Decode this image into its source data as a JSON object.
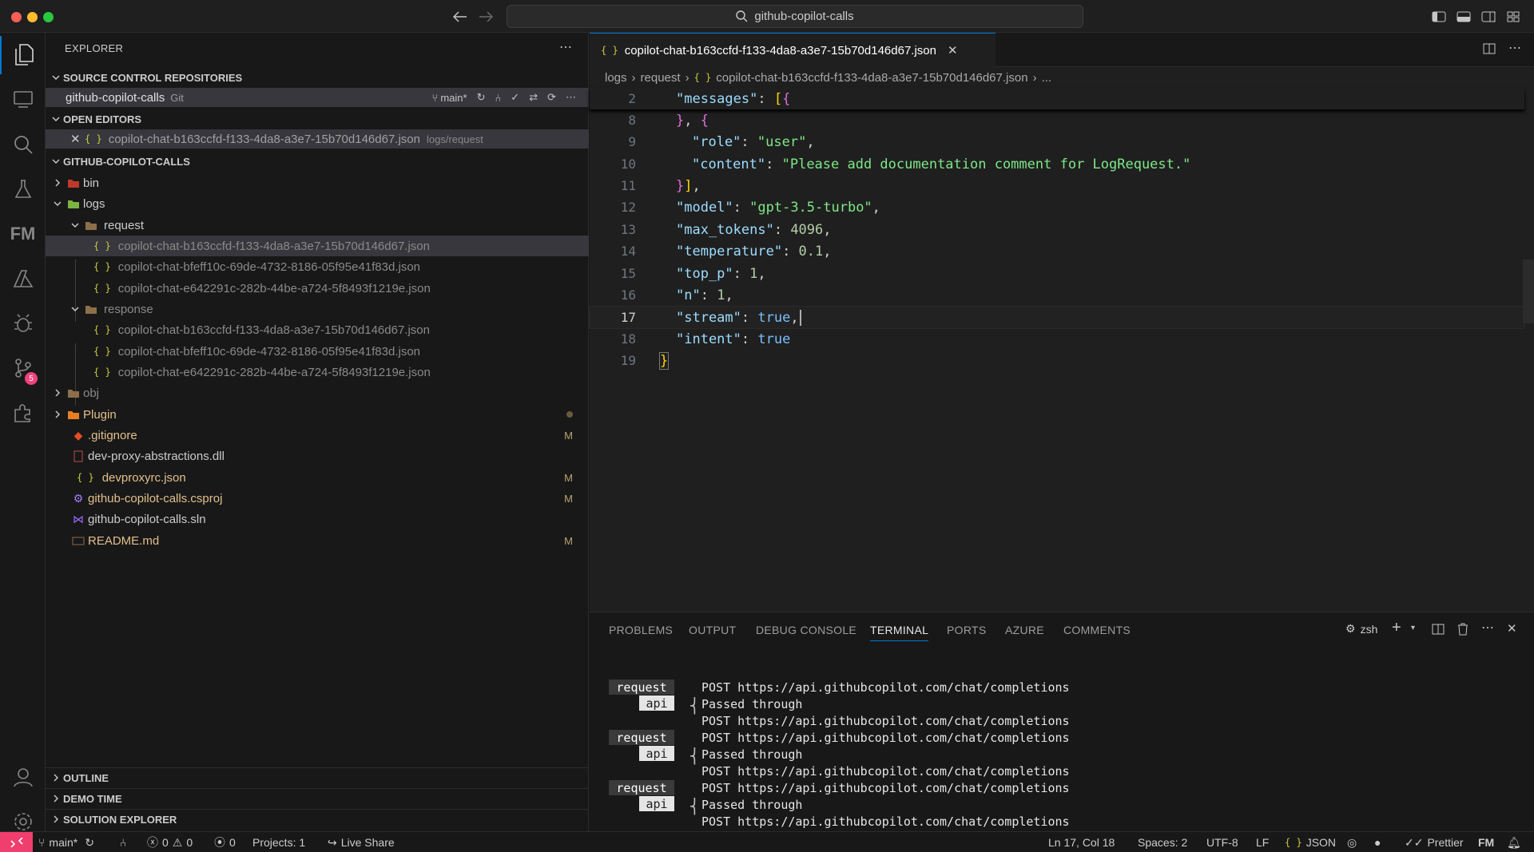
{
  "titlebar": {
    "search": "github-copilot-calls"
  },
  "activity": {
    "source_control_badge": "5"
  },
  "explorer": {
    "header": "EXPLORER",
    "scm_section": "SOURCE CONTROL REPOSITORIES",
    "repo": {
      "name": "github-copilot-calls",
      "type": "Git",
      "branch": "main*"
    },
    "open_editors_section": "OPEN EDITORS",
    "open_editor": {
      "name": "copilot-chat-b163ccfd-f133-4da8-a3e7-15b70d146d67.json",
      "path": "logs/request"
    },
    "folder_section": "GITHUB-COPILOT-CALLS",
    "tree": {
      "bin": "bin",
      "logs": "logs",
      "request": "request",
      "req1": "copilot-chat-b163ccfd-f133-4da8-a3e7-15b70d146d67.json",
      "req2": "copilot-chat-bfeff10c-69de-4732-8186-05f95e41f83d.json",
      "req3": "copilot-chat-e642291c-282b-44be-a724-5f8493f1219e.json",
      "response": "response",
      "res1": "copilot-chat-b163ccfd-f133-4da8-a3e7-15b70d146d67.json",
      "res2": "copilot-chat-bfeff10c-69de-4732-8186-05f95e41f83d.json",
      "res3": "copilot-chat-e642291c-282b-44be-a724-5f8493f1219e.json",
      "obj": "obj",
      "plugin": "Plugin",
      "gitignore": ".gitignore",
      "dll": "dev-proxy-abstractions.dll",
      "devproxyrc": "devproxyrc.json",
      "csproj": "github-copilot-calls.csproj",
      "sln": "github-copilot-calls.sln",
      "readme": "README.md"
    },
    "modified_flag": "M",
    "outline": "OUTLINE",
    "demo_time": "DEMO TIME",
    "solution_explorer": "SOLUTION EXPLORER"
  },
  "editor": {
    "tab_title": "copilot-chat-b163ccfd-f133-4da8-a3e7-15b70d146d67.json",
    "breadcrumb": [
      "logs",
      "request",
      "copilot-chat-b163ccfd-f133-4da8-a3e7-15b70d146d67.json",
      "..."
    ],
    "line_numbers": [
      "2",
      "8",
      "9",
      "10",
      "11",
      "12",
      "13",
      "14",
      "15",
      "16",
      "17",
      "18",
      "19"
    ],
    "code": {
      "l2_key": "\"messages\"",
      "l9_key": "\"role\"",
      "l9_val": "\"user\"",
      "l10_key": "\"content\"",
      "l10_val": "\"Please add documentation comment for LogRequest.\"",
      "l12_key": "\"model\"",
      "l12_val": "\"gpt-3.5-turbo\"",
      "l13_key": "\"max_tokens\"",
      "l13_val": "4096",
      "l14_key": "\"temperature\"",
      "l14_val": "0.1",
      "l15_key": "\"top_p\"",
      "l15_val": "1",
      "l16_key": "\"n\"",
      "l16_val": "1",
      "l17_key": "\"stream\"",
      "l17_val": "true",
      "l18_key": "\"intent\"",
      "l18_val": "true"
    }
  },
  "panel": {
    "tabs": [
      "PROBLEMS",
      "OUTPUT",
      "DEBUG CONSOLE",
      "TERMINAL",
      "PORTS",
      "AZURE",
      "COMMENTS"
    ],
    "shell": "zsh",
    "label_request": "request",
    "label_api": "api",
    "post_line": "POST https://api.githubcopilot.com/chat/completions",
    "passed": "Passed through"
  },
  "status": {
    "branch": "main*",
    "errors": "0",
    "warnings": "0",
    "ports": "0",
    "projects": "Projects: 1",
    "live_share": "Live Share",
    "position": "Ln 17, Col 18",
    "spaces": "Spaces: 2",
    "encoding": "UTF-8",
    "eol": "LF",
    "language": "JSON",
    "prettier": "Prettier"
  },
  "colors": {
    "accent": "#0078d4",
    "remote": "#f03e6e",
    "modified": "#e2c08d",
    "string": "#7ee787"
  }
}
